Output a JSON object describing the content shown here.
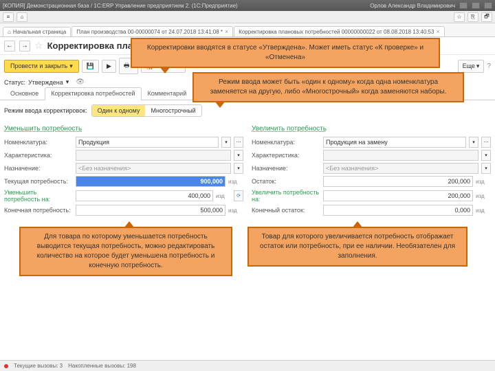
{
  "title_left": "[КОПИЯ] Демонстрационная база / 1С:ERP Управление предприятием 2. (1С:Предприятие)",
  "title_right": "Орлов Александр Владимирович",
  "tabs": {
    "t0": "Начальная страница",
    "t1": "План производства 00-00000074 от 24.07.2018 13:41:08 *",
    "t2": "Корректировка плановых потребностей 00000000022 от 08.08.2018 13:40:53"
  },
  "page_title": "Корректировка плановых потребностей 00000000022 от 08.08.2018 13:40:53",
  "btn_primary": "Провести и закрыть",
  "btn_reports": "Отчеты",
  "btn_more": "Еще",
  "status_label": "Статус:",
  "status_value": "Утверждена",
  "subtabs": {
    "s0": "Основное",
    "s1": "Корректировка потребностей",
    "s2": "Комментарий"
  },
  "mode_label": "Режим ввода корректировок:",
  "mode_a": "Один к одному",
  "mode_b": "Многострочный",
  "left": {
    "title": "Уменьшить потребность",
    "nom_l": "Номенклатура:",
    "nom_v": "Продукция",
    "char_l": "Характеристика:",
    "nazn_l": "Назначение:",
    "nazn_v": "<Без назначения>",
    "cur_l": "Текущая потребность:",
    "cur_v": "900,000",
    "red_l": "Уменьшить потребность на:",
    "red_v": "400,000",
    "fin_l": "Конечная потребность:",
    "fin_v": "500,000"
  },
  "right": {
    "title": "Увеличить потребность",
    "nom_l": "Номенклатура:",
    "nom_v": "Продукция на замену",
    "char_l": "Характеристика:",
    "nazn_l": "Назначение:",
    "nazn_v": "<Без назначения>",
    "ost_l": "Остаток:",
    "ost_v": "200,000",
    "inc_l": "Увеличить потребность на:",
    "inc_v": "200,000",
    "fin_l": "Конечный остаток:",
    "fin_v": "0,000"
  },
  "unit": "изд",
  "callouts": {
    "c1": "Корректировки вводятся в статусе «Утверждена». Может иметь статус «К проверке» и «Отменена»",
    "c2": "Режим ввода может быть «один к одному» когда одна номенклатура заменяется на другую, либо «Многострочный» когда заменяются наборы.",
    "c3": "Для товара по которому уменьшается потребность выводится текущая потребность, можно редактировать количество на которое будет уменьшена потребность и конечную потребность.",
    "c4": "Товар для которого увеличивается потребность отображает остаток или потребность, при ее наличии. Необязателен для заполнения."
  },
  "status_cur": "Текущие вызовы: 3",
  "status_acc": "Накопленные вызовы: 198"
}
